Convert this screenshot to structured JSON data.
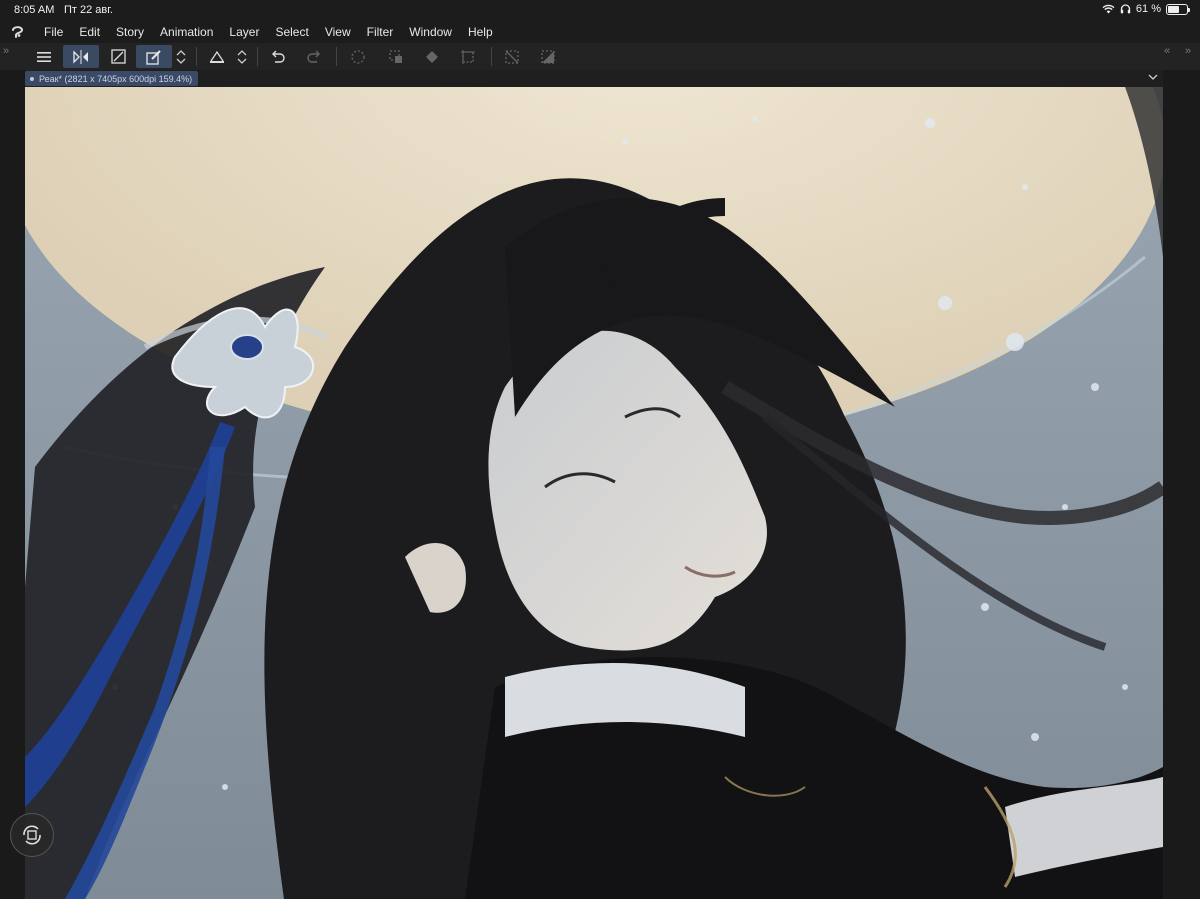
{
  "status": {
    "time": "8:05 AM",
    "date": "Пт 22 авг.",
    "battery": "61 %",
    "battery_level": 0.61
  },
  "menu": [
    "File",
    "Edit",
    "Story",
    "Animation",
    "Layer",
    "Select",
    "View",
    "Filter",
    "Window",
    "Help"
  ],
  "toolbar": {
    "icons": [
      "hamburger-menu-icon",
      "flip-horizontal-icon",
      "transform-icon",
      "edit-canvas-icon",
      "ruler-icon",
      "undo-icon",
      "redo-icon",
      "select-all-icon",
      "deselect-icon",
      "fill-icon",
      "crop-icon",
      "clear-selection-icon",
      "invert-icon"
    ]
  },
  "document": {
    "tab_label": "Реак* (2821 x 7405px 600dpi 159.4%)"
  },
  "colors": {
    "accent": "#3b4a63",
    "moon": "#e8dcc4",
    "sky": "#8e9aa6",
    "hair": "#1c1c1f",
    "ribbon": "#1f3f8e"
  }
}
